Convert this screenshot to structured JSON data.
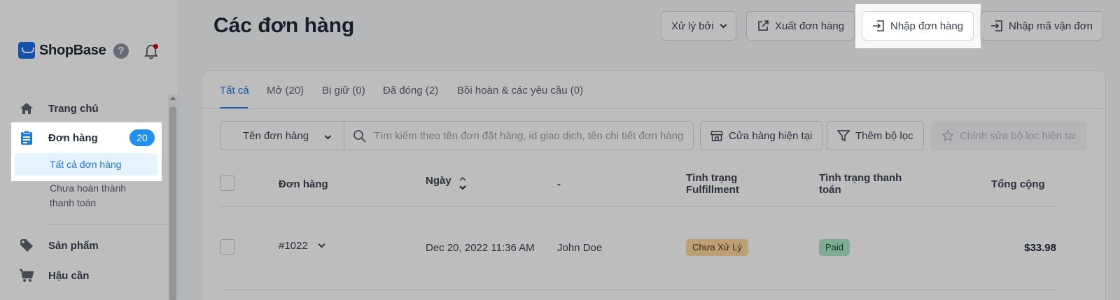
{
  "app": {
    "logo_text": "ShopBase",
    "help_glyph": "?"
  },
  "sidebar": {
    "items": [
      {
        "label": "Trang chủ",
        "icon": "home-icon"
      },
      {
        "label": "Đơn hàng",
        "icon": "clipboard-icon",
        "badge": "20",
        "active": true
      },
      {
        "label": "Sản phẩm",
        "icon": "tag-icon"
      },
      {
        "label": "Hậu cần",
        "icon": "cart-icon"
      }
    ],
    "sub_items": [
      {
        "label": "Tất cả đơn hàng",
        "active": true
      },
      {
        "label": "Chưa hoàn thành thanh toán"
      }
    ]
  },
  "header": {
    "title": "Các đơn hàng",
    "processed_by": "Xử lý bởi",
    "export": "Xuất đơn hàng",
    "import": "Nhập đơn hàng",
    "import_tracking": "Nhập mã vận đơn"
  },
  "tabs": [
    {
      "label": "Tất cả",
      "active": true
    },
    {
      "label": "Mở (20)"
    },
    {
      "label": "Bị giữ (0)"
    },
    {
      "label": "Đã đóng (2)"
    },
    {
      "label": "Bồi hoàn & các yêu cầu (0)"
    }
  ],
  "filters": {
    "select_value": "Tên đơn hàng",
    "search_placeholder": "Tìm kiếm theo tên đơn đặt hàng, id giao dịch, tên chi tiết đơn hàng",
    "current_store": "Cửa hàng hiện tại",
    "add_filter": "Thêm bộ lọc",
    "edit_filter": "Chỉnh sửa bộ lọc hiện tại"
  },
  "table": {
    "headers": {
      "order": "Đơn hàng",
      "date": "Ngày",
      "customer": "-",
      "fulfillment_1": "Tình trạng",
      "fulfillment_2": "Fulfillment",
      "payment_1": "Tình trạng thanh",
      "payment_2": "toán",
      "total": "Tổng cộng"
    },
    "rows": [
      {
        "order": "#1022",
        "date": "Dec 20, 2022 11:36 AM",
        "customer": "John Doe",
        "fulfillment": "Chưa Xử Lý",
        "payment": "Paid",
        "total": "$33.98"
      }
    ]
  },
  "colors": {
    "accent": "#1f7ae0",
    "badge_blue": "#1f90f0",
    "fulfillment_badge": "#ffd79d",
    "payment_badge": "#aee9c8"
  }
}
